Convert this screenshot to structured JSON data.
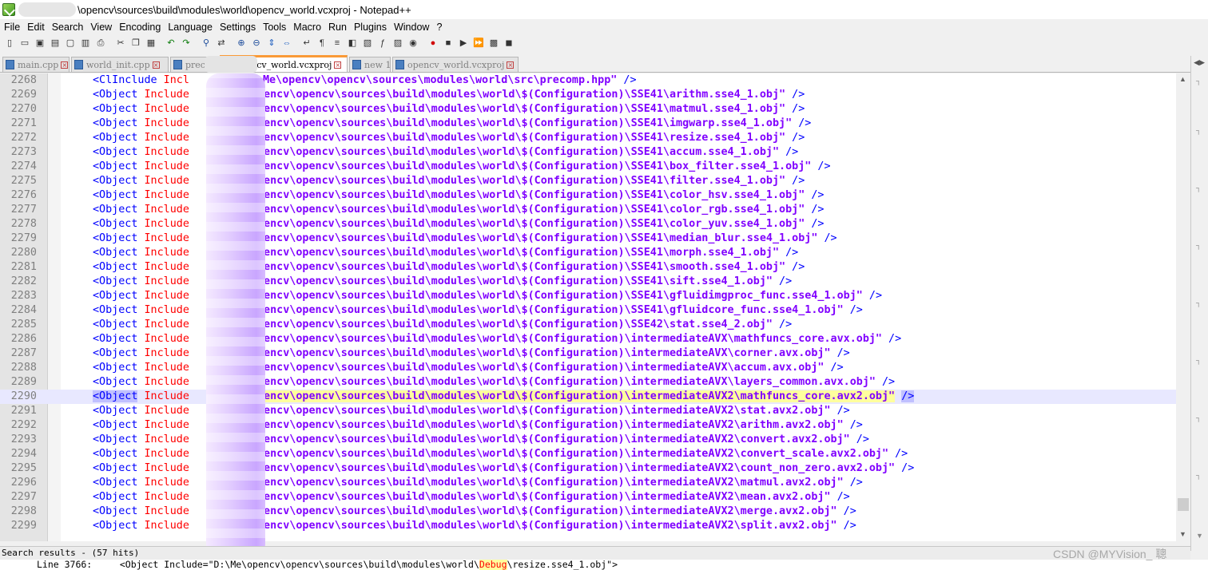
{
  "window": {
    "title": "\\opencv\\sources\\build\\modules\\world\\opencv_world.vcxproj - Notepad++"
  },
  "menu": {
    "items": [
      "File",
      "Edit",
      "Search",
      "View",
      "Encoding",
      "Language",
      "Settings",
      "Tools",
      "Macro",
      "Run",
      "Plugins",
      "Window",
      "?"
    ]
  },
  "toolbar": {
    "icons": [
      "new-file-icon",
      "open-file-icon",
      "save-icon",
      "save-all-icon",
      "close-icon",
      "close-all-icon",
      "print-icon",
      "cut-icon",
      "copy-icon",
      "paste-icon",
      "undo-icon",
      "redo-icon",
      "find-icon",
      "replace-icon",
      "zoom-in-icon",
      "zoom-out-icon",
      "sync-v-icon",
      "sync-h-icon",
      "word-wrap-icon",
      "show-all-chars-icon",
      "indent-guide-icon",
      "user-lang-icon",
      "doc-map-icon",
      "function-list-icon",
      "folder-workspace-icon",
      "monitor-icon",
      "record-macro-icon",
      "stop-record-icon",
      "play-macro-icon",
      "run-macro-multiple-icon",
      "save-macro-icon",
      "npp-logo-icon"
    ]
  },
  "tabs": [
    {
      "label": "main.cpp",
      "active": false
    },
    {
      "label": "world_init.cpp",
      "active": false
    },
    {
      "label": "prec",
      "active": false
    },
    {
      "label": "opencv_world.vcxproj",
      "active": true
    },
    {
      "label": "new 1",
      "active": false
    },
    {
      "label": "opencv_world.vcxproj",
      "active": false
    }
  ],
  "editor": {
    "current_line": "2290",
    "lines": [
      {
        "num": "2268",
        "tag": "<ClInclude",
        "attr": " Incl",
        "val": "Me\\opencv\\opencv\\sources\\modules\\world\\src\\precomp.hpp\"",
        "end": " />"
      },
      {
        "num": "2269",
        "tag": "<Object",
        "attr": " Include",
        "val": "opencv\\opencv\\sources\\build\\modules\\world\\$(Configuration)\\SSE41\\arithm.sse4_1.obj\"",
        "end": " />"
      },
      {
        "num": "2270",
        "tag": "<Object",
        "attr": " Include",
        "val": "opencv\\opencv\\sources\\build\\modules\\world\\$(Configuration)\\SSE41\\matmul.sse4_1.obj\"",
        "end": " />"
      },
      {
        "num": "2271",
        "tag": "<Object",
        "attr": " Include",
        "val": "opencv\\opencv\\sources\\build\\modules\\world\\$(Configuration)\\SSE41\\imgwarp.sse4_1.obj\"",
        "end": " />"
      },
      {
        "num": "2272",
        "tag": "<Object",
        "attr": " Include",
        "val": "opencv\\opencv\\sources\\build\\modules\\world\\$(Configuration)\\SSE41\\resize.sse4_1.obj\"",
        "end": " />"
      },
      {
        "num": "2273",
        "tag": "<Object",
        "attr": " Include",
        "val": "opencv\\opencv\\sources\\build\\modules\\world\\$(Configuration)\\SSE41\\accum.sse4_1.obj\"",
        "end": " />"
      },
      {
        "num": "2274",
        "tag": "<Object",
        "attr": " Include",
        "val": "opencv\\opencv\\sources\\build\\modules\\world\\$(Configuration)\\SSE41\\box_filter.sse4_1.obj\"",
        "end": " />"
      },
      {
        "num": "2275",
        "tag": "<Object",
        "attr": " Include",
        "val": "opencv\\opencv\\sources\\build\\modules\\world\\$(Configuration)\\SSE41\\filter.sse4_1.obj\"",
        "end": " />"
      },
      {
        "num": "2276",
        "tag": "<Object",
        "attr": " Include",
        "val": "opencv\\opencv\\sources\\build\\modules\\world\\$(Configuration)\\SSE41\\color_hsv.sse4_1.obj\"",
        "end": " />"
      },
      {
        "num": "2277",
        "tag": "<Object",
        "attr": " Include",
        "val": "opencv\\opencv\\sources\\build\\modules\\world\\$(Configuration)\\SSE41\\color_rgb.sse4_1.obj\"",
        "end": " />"
      },
      {
        "num": "2278",
        "tag": "<Object",
        "attr": " Include",
        "val": "opencv\\opencv\\sources\\build\\modules\\world\\$(Configuration)\\SSE41\\color_yuv.sse4_1.obj\"",
        "end": " />"
      },
      {
        "num": "2279",
        "tag": "<Object",
        "attr": " Include",
        "val": "opencv\\opencv\\sources\\build\\modules\\world\\$(Configuration)\\SSE41\\median_blur.sse4_1.obj\"",
        "end": " />"
      },
      {
        "num": "2280",
        "tag": "<Object",
        "attr": " Include",
        "val": "opencv\\opencv\\sources\\build\\modules\\world\\$(Configuration)\\SSE41\\morph.sse4_1.obj\"",
        "end": " />"
      },
      {
        "num": "2281",
        "tag": "<Object",
        "attr": " Include",
        "val": "opencv\\opencv\\sources\\build\\modules\\world\\$(Configuration)\\SSE41\\smooth.sse4_1.obj\"",
        "end": " />"
      },
      {
        "num": "2282",
        "tag": "<Object",
        "attr": " Include",
        "val": "opencv\\opencv\\sources\\build\\modules\\world\\$(Configuration)\\SSE41\\sift.sse4_1.obj\"",
        "end": " />"
      },
      {
        "num": "2283",
        "tag": "<Object",
        "attr": " Include",
        "val": "opencv\\opencv\\sources\\build\\modules\\world\\$(Configuration)\\SSE41\\gfluidimgproc_func.sse4_1.obj\"",
        "end": " />"
      },
      {
        "num": "2284",
        "tag": "<Object",
        "attr": " Include",
        "val": "opencv\\opencv\\sources\\build\\modules\\world\\$(Configuration)\\SSE41\\gfluidcore_func.sse4_1.obj\"",
        "end": " />"
      },
      {
        "num": "2285",
        "tag": "<Object",
        "attr": " Include",
        "val": "opencv\\opencv\\sources\\build\\modules\\world\\$(Configuration)\\SSE42\\stat.sse4_2.obj\"",
        "end": " />"
      },
      {
        "num": "2286",
        "tag": "<Object",
        "attr": " Include",
        "val": "opencv\\opencv\\sources\\build\\modules\\world\\$(Configuration)\\intermediateAVX\\mathfuncs_core.avx.obj\"",
        "end": " />"
      },
      {
        "num": "2287",
        "tag": "<Object",
        "attr": " Include",
        "val": "opencv\\opencv\\sources\\build\\modules\\world\\$(Configuration)\\intermediateAVX\\corner.avx.obj\"",
        "end": " />"
      },
      {
        "num": "2288",
        "tag": "<Object",
        "attr": " Include",
        "val": "opencv\\opencv\\sources\\build\\modules\\world\\$(Configuration)\\intermediateAVX\\accum.avx.obj\"",
        "end": " />"
      },
      {
        "num": "2289",
        "tag": "<Object",
        "attr": " Include",
        "val": "opencv\\opencv\\sources\\build\\modules\\world\\$(Configuration)\\intermediateAVX\\layers_common.avx.obj\"",
        "end": " />"
      },
      {
        "num": "2290",
        "tag": "<Object",
        "attr": " Include",
        "val": "opencv\\opencv\\sources\\build\\modules\\world\\$(Configuration)\\intermediateAVX2\\mathfuncs_core.avx2.obj\"",
        "end": " />"
      },
      {
        "num": "2291",
        "tag": "<Object",
        "attr": " Include",
        "val": "opencv\\opencv\\sources\\build\\modules\\world\\$(Configuration)\\intermediateAVX2\\stat.avx2.obj\"",
        "end": " />"
      },
      {
        "num": "2292",
        "tag": "<Object",
        "attr": " Include",
        "val": "opencv\\opencv\\sources\\build\\modules\\world\\$(Configuration)\\intermediateAVX2\\arithm.avx2.obj\"",
        "end": " />"
      },
      {
        "num": "2293",
        "tag": "<Object",
        "attr": " Include",
        "val": "opencv\\opencv\\sources\\build\\modules\\world\\$(Configuration)\\intermediateAVX2\\convert.avx2.obj\"",
        "end": " />"
      },
      {
        "num": "2294",
        "tag": "<Object",
        "attr": " Include",
        "val": "opencv\\opencv\\sources\\build\\modules\\world\\$(Configuration)\\intermediateAVX2\\convert_scale.avx2.obj\"",
        "end": " />"
      },
      {
        "num": "2295",
        "tag": "<Object",
        "attr": " Include",
        "val": "opencv\\opencv\\sources\\build\\modules\\world\\$(Configuration)\\intermediateAVX2\\count_non_zero.avx2.obj\"",
        "end": " />"
      },
      {
        "num": "2296",
        "tag": "<Object",
        "attr": " Include",
        "val": "opencv\\opencv\\sources\\build\\modules\\world\\$(Configuration)\\intermediateAVX2\\matmul.avx2.obj\"",
        "end": " />"
      },
      {
        "num": "2297",
        "tag": "<Object",
        "attr": " Include",
        "val": "opencv\\opencv\\sources\\build\\modules\\world\\$(Configuration)\\intermediateAVX2\\mean.avx2.obj\"",
        "end": " />"
      },
      {
        "num": "2298",
        "tag": "<Object",
        "attr": " Include",
        "val": "opencv\\opencv\\sources\\build\\modules\\world\\$(Configuration)\\intermediateAVX2\\merge.avx2.obj\"",
        "end": " />"
      },
      {
        "num": "2299",
        "tag": "<Object",
        "attr": " Include",
        "val": "opencv\\opencv\\sources\\build\\modules\\world\\$(Configuration)\\intermediateAVX2\\split.avx2.obj\"",
        "end": " />"
      }
    ]
  },
  "search_results": {
    "header": "Search results - (57 hits)",
    "line_prefix": "Line 3766:     <Object Include=\"D:\\Me\\opencv\\opencv\\sources\\build\\modules\\world\\",
    "line_highlight": "Debug",
    "line_suffix": "\\resize.sse4_1.obj\">"
  },
  "watermark": "CSDN @MYVision_ 聰",
  "colors": {
    "tag": "#0000ff",
    "attr": "#ff0000",
    "value": "#8000ff",
    "current_line_bg": "#e8e8ff",
    "active_tab_accent": "#fa9a37"
  }
}
